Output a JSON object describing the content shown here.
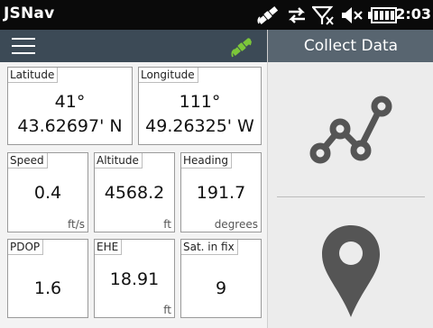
{
  "status_bar": {
    "app_title": "JSNav",
    "time": "2:03",
    "icons": [
      "satellite-icon",
      "sync-icon",
      "no-signal-icon",
      "volume-muted-icon",
      "battery-icon"
    ]
  },
  "toolbar": {
    "menu_icon": "hamburger-menu-icon",
    "gps_icon": "satellite-status-icon",
    "gps_icon_color": "#7cc63a",
    "bg_color": "#3c4a56"
  },
  "fields": {
    "latitude": {
      "label": "Latitude",
      "value_line1": "41°",
      "value_line2": "43.62697' N"
    },
    "longitude": {
      "label": "Longitude",
      "value_line1": "111°",
      "value_line2": "49.26325' W"
    },
    "speed": {
      "label": "Speed",
      "value": "0.4",
      "unit": "ft/s"
    },
    "altitude": {
      "label": "Altitude",
      "value": "4568.2",
      "unit": "ft"
    },
    "heading": {
      "label": "Heading",
      "value": "191.7",
      "unit": "degrees"
    },
    "pdop": {
      "label": "PDOP",
      "value": "1.6",
      "unit": ""
    },
    "ehe": {
      "label": "EHE",
      "value": "18.91",
      "unit": "ft"
    },
    "sats": {
      "label": "Sat. in fix",
      "value": "9",
      "unit": ""
    }
  },
  "collect_panel": {
    "title": "Collect Data",
    "header_color": "#586570",
    "buttons": [
      {
        "name": "collect-line",
        "icon": "polyline-icon"
      },
      {
        "name": "collect-point",
        "icon": "map-pin-icon"
      }
    ],
    "icon_color": "#555555"
  }
}
